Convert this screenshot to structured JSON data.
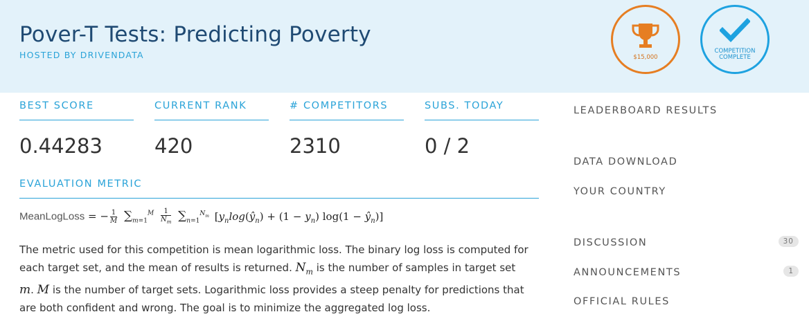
{
  "header": {
    "title": "Pover-T Tests: Predicting Poverty",
    "hosted_by": "HOSTED BY DRIVENDATA",
    "prize_badge": {
      "amount": "$15,000",
      "icon": "trophy-icon",
      "color": "#e67e22"
    },
    "status_badge": {
      "line1": "COMPETITION",
      "line2": "COMPLETE",
      "icon": "check-icon",
      "color": "#1ea2e0"
    }
  },
  "stats": [
    {
      "label": "BEST SCORE",
      "value": "0.44283"
    },
    {
      "label": "CURRENT RANK",
      "value": "420"
    },
    {
      "label": "# COMPETITORS",
      "value": "2310"
    },
    {
      "label": "SUBS. TODAY",
      "value": "0 / 2"
    }
  ],
  "metric": {
    "label": "EVALUATION METRIC",
    "formula_name": "MeanLogLoss",
    "description_part1": "The metric used for this competition is mean logarithmic loss. The binary log loss is computed for each target set, and the mean of results is returned.",
    "description_part2": "is the number of samples in target set",
    "description_part3": "is the number of target sets. Logarithmic loss provides a steep penalty for predictions that are both confident and wrong. The goal is to minimize the aggregated log loss."
  },
  "sidebar": {
    "leaderboard": "LEADERBOARD RESULTS",
    "data_download": "DATA DOWNLOAD",
    "your_country": "YOUR COUNTRY",
    "discussion": "DISCUSSION",
    "discussion_count": "30",
    "announcements": "ANNOUNCEMENTS",
    "announcements_count": "1",
    "official_rules": "OFFICIAL RULES"
  },
  "colors": {
    "accent": "#2aa3d8",
    "header_bg": "#e3f2fa",
    "title": "#1f4a73"
  }
}
